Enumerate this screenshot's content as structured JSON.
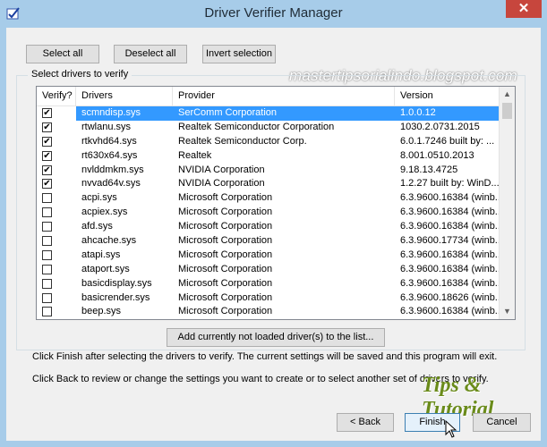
{
  "window": {
    "title": "Driver Verifier Manager",
    "close_glyph": "✕"
  },
  "toolbar": {
    "select_all": "Select all",
    "deselect_all": "Deselect all",
    "invert_selection": "Invert selection"
  },
  "group": {
    "label": "Select drivers to verify"
  },
  "table": {
    "columns": [
      "Verify?",
      "Drivers",
      "Provider",
      "Version"
    ],
    "rows": [
      {
        "checked": true,
        "driver": "scmndisp.sys",
        "provider": "SerComm Corporation",
        "version": "1.0.0.12",
        "selected": true
      },
      {
        "checked": true,
        "driver": "rtwlanu.sys",
        "provider": "Realtek Semiconductor Corporation",
        "version": "1030.2.0731.2015",
        "selected": false
      },
      {
        "checked": true,
        "driver": "rtkvhd64.sys",
        "provider": "Realtek Semiconductor Corp.",
        "version": "6.0.1.7246 built by: ...",
        "selected": false
      },
      {
        "checked": true,
        "driver": "rt630x64.sys",
        "provider": "Realtek",
        "version": "8.001.0510.2013",
        "selected": false
      },
      {
        "checked": true,
        "driver": "nvlddmkm.sys",
        "provider": "NVIDIA Corporation",
        "version": "9.18.13.4725",
        "selected": false
      },
      {
        "checked": true,
        "driver": "nvvad64v.sys",
        "provider": "NVIDIA Corporation",
        "version": "1.2.27 built by: WinD...",
        "selected": false
      },
      {
        "checked": false,
        "driver": "acpi.sys",
        "provider": "Microsoft Corporation",
        "version": "6.3.9600.16384 (winb...",
        "selected": false
      },
      {
        "checked": false,
        "driver": "acpiex.sys",
        "provider": "Microsoft Corporation",
        "version": "6.3.9600.16384 (winb...",
        "selected": false
      },
      {
        "checked": false,
        "driver": "afd.sys",
        "provider": "Microsoft Corporation",
        "version": "6.3.9600.16384 (winb...",
        "selected": false
      },
      {
        "checked": false,
        "driver": "ahcache.sys",
        "provider": "Microsoft Corporation",
        "version": "6.3.9600.17734 (winb...",
        "selected": false
      },
      {
        "checked": false,
        "driver": "atapi.sys",
        "provider": "Microsoft Corporation",
        "version": "6.3.9600.16384 (winb...",
        "selected": false
      },
      {
        "checked": false,
        "driver": "ataport.sys",
        "provider": "Microsoft Corporation",
        "version": "6.3.9600.16384 (winb...",
        "selected": false
      },
      {
        "checked": false,
        "driver": "basicdisplay.sys",
        "provider": "Microsoft Corporation",
        "version": "6.3.9600.16384 (winb...",
        "selected": false
      },
      {
        "checked": false,
        "driver": "basicrender.sys",
        "provider": "Microsoft Corporation",
        "version": "6.3.9600.18626 (winb...",
        "selected": false
      },
      {
        "checked": false,
        "driver": "beep.sys",
        "provider": "Microsoft Corporation",
        "version": "6.3.9600.16384 (winb...",
        "selected": false
      }
    ]
  },
  "add_button": "Add currently not loaded driver(s) to the list...",
  "info": {
    "line1": "Click Finish after selecting the drivers to verify. The current settings will be saved and this program will exit.",
    "line2": "Click Back to review or change the settings you want to create or to select another set of drivers to verify."
  },
  "footer": {
    "back": "< Back",
    "finish": "Finish",
    "cancel": "Cancel"
  },
  "watermark": "mastertipsorialindo.blogspot.com",
  "logo": "Tips & Tutorial",
  "colors": {
    "selection": "#3399ff",
    "titlebar": "#a7cce9",
    "close": "#c7463d"
  }
}
